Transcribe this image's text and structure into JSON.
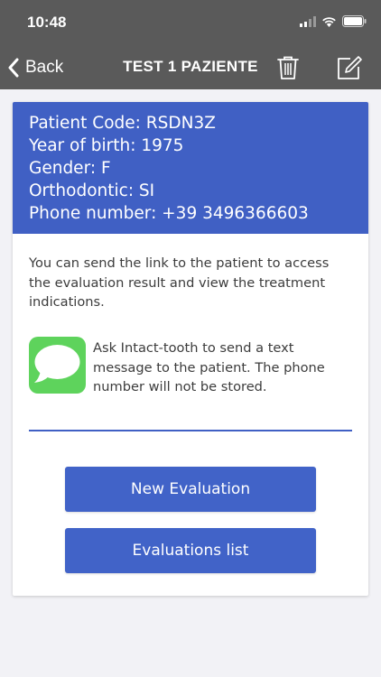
{
  "status_bar": {
    "time": "10:48"
  },
  "nav": {
    "back_label": "Back",
    "title": "TEST 1 PAZIENTE"
  },
  "patient": {
    "lines": [
      "Patient Code: RSDN3Z",
      "Year of birth: 1975",
      "Gender: F",
      "Orthodontic: SI",
      "Phone number: +39 3496366603"
    ]
  },
  "main": {
    "link_text": "You can send the link to the patient to access the evaluation result and view the treatment indications.",
    "sms_text": "Ask Intact-tooth to send a text message to the patient. The phone number will not be stored.",
    "new_evaluation_label": "New Evaluation",
    "evaluations_list_label": "Evaluations list"
  },
  "colors": {
    "nav_bg": "#5a5a5a",
    "accent": "#4060c4",
    "sms_green": "#5ed35c"
  },
  "icons": [
    "chevron-left-icon",
    "trash-icon",
    "edit-icon",
    "message-bubble-icon",
    "signal-icon",
    "wifi-icon",
    "battery-icon"
  ]
}
